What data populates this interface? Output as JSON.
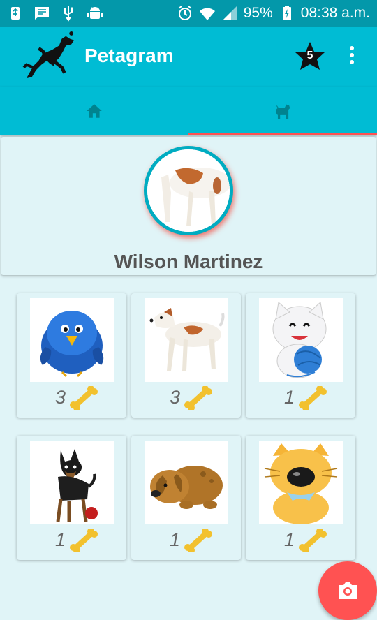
{
  "status_bar": {
    "battery_percent": "95%",
    "time": "08:38 a.m.",
    "icons": [
      "usb-icon",
      "message-icon",
      "usb-debug-icon",
      "android-icon",
      "alarm-icon",
      "wifi-icon",
      "signal-icon",
      "battery-charging-icon"
    ]
  },
  "app_bar": {
    "title": "Petagram",
    "favorites_badge": "5",
    "colors": {
      "primary": "#00bcd4",
      "primary_dark": "#0398aa",
      "accent": "#ff5252"
    }
  },
  "tabs": [
    {
      "name": "home",
      "icon": "home-icon",
      "selected": false
    },
    {
      "name": "pet-profile",
      "icon": "dog-icon",
      "selected": true
    }
  ],
  "profile": {
    "name": "Wilson Martinez",
    "avatar": "jack-russell-dog"
  },
  "pets": [
    {
      "picture": "blue-bird",
      "likes": "3"
    },
    {
      "picture": "jack-russell-dog",
      "likes": "3"
    },
    {
      "picture": "white-cat-with-yarn",
      "likes": "1"
    },
    {
      "picture": "black-chihuahua-with-ball",
      "likes": "1"
    },
    {
      "picture": "brown-puppy",
      "likes": "1"
    },
    {
      "picture": "yellow-cat-with-bow",
      "likes": "1"
    }
  ],
  "fab": {
    "icon": "camera-icon"
  }
}
